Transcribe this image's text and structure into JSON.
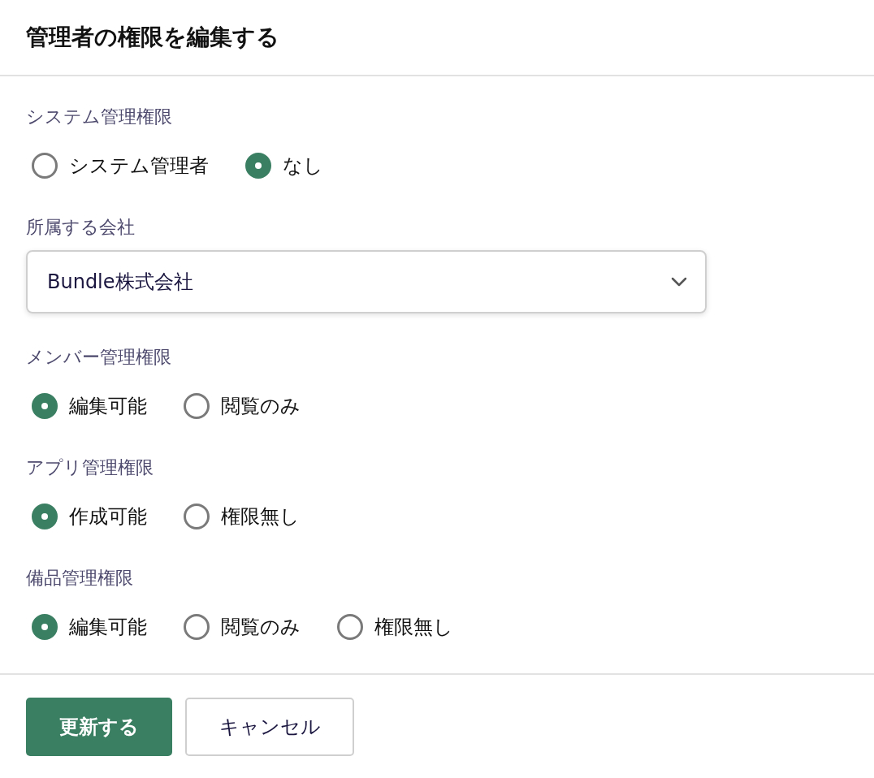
{
  "title": "管理者の権限を編集する",
  "sections": [
    {
      "kind": "radio",
      "label": "システム管理権限",
      "options": [
        {
          "label": "システム管理者",
          "selected": false
        },
        {
          "label": "なし",
          "selected": true
        }
      ]
    },
    {
      "kind": "select",
      "label": "所属する会社",
      "value": "Bundle株式会社"
    },
    {
      "kind": "radio",
      "label": "メンバー管理権限",
      "options": [
        {
          "label": "編集可能",
          "selected": true
        },
        {
          "label": "閲覧のみ",
          "selected": false
        }
      ]
    },
    {
      "kind": "radio",
      "label": "アプリ管理権限",
      "options": [
        {
          "label": "作成可能",
          "selected": true
        },
        {
          "label": "権限無し",
          "selected": false
        }
      ]
    },
    {
      "kind": "radio",
      "label": "備品管理権限",
      "options": [
        {
          "label": "編集可能",
          "selected": true
        },
        {
          "label": "閲覧のみ",
          "selected": false
        },
        {
          "label": "権限無し",
          "selected": false
        }
      ]
    }
  ],
  "buttons": [
    {
      "label": "更新する",
      "kind": "primary"
    },
    {
      "label": "キャンセル",
      "kind": "secondary"
    }
  ]
}
